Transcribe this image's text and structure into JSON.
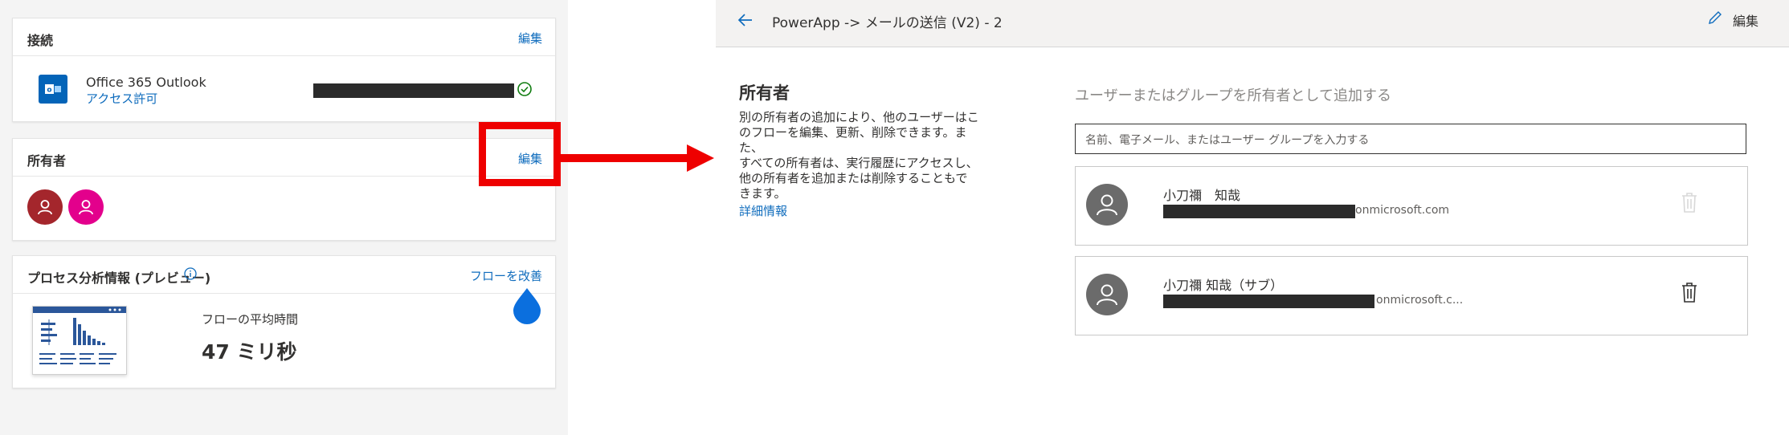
{
  "left": {
    "connections": {
      "title": "接続",
      "edit": "編集",
      "connector_name": "Office 365 Outlook",
      "permission_link": "アクセス許可",
      "connector_icon": "outlook-icon",
      "status_icon": "check-circle-icon"
    },
    "owners": {
      "title": "所有者",
      "edit": "編集",
      "avatar_colors": [
        "#a4262c",
        "#e3008c"
      ]
    },
    "process": {
      "title": "プロセス分析情報 (プレビュー)",
      "info_icon": "info-icon",
      "improve_link": "フローを改善",
      "avg_label": "フローの平均時間",
      "avg_value": "47 ミリ秒"
    }
  },
  "right": {
    "header": {
      "title": "PowerApp -> メールの送信 (V2) - 2",
      "edit": "編集",
      "back_icon": "back-arrow-icon",
      "edit_icon": "pencil-icon"
    },
    "owners": {
      "heading": "所有者",
      "description_lines": [
        "別の所有者の追加により、他のユーザーはこ",
        "のフローを編集、更新、削除できます。また、",
        "すべての所有者は、実行履歴にアクセスし、",
        "他の所有者を追加または削除することもで",
        "きます。"
      ],
      "more_info": "詳細情報",
      "add_label": "ユーザーまたはグループを所有者として追加する",
      "input_placeholder": "名前、電子メール、またはユーザー グループを入力する",
      "list": [
        {
          "name": "小刀禰　知哉",
          "email_suffix": "onmicrosoft.com"
        },
        {
          "name": "小刀禰 知哉（サブ）",
          "email_suffix": "onmicrosoft.c..."
        }
      ]
    }
  },
  "colors": {
    "accent": "#0f6cbd",
    "highlight_red": "#ee0000"
  }
}
